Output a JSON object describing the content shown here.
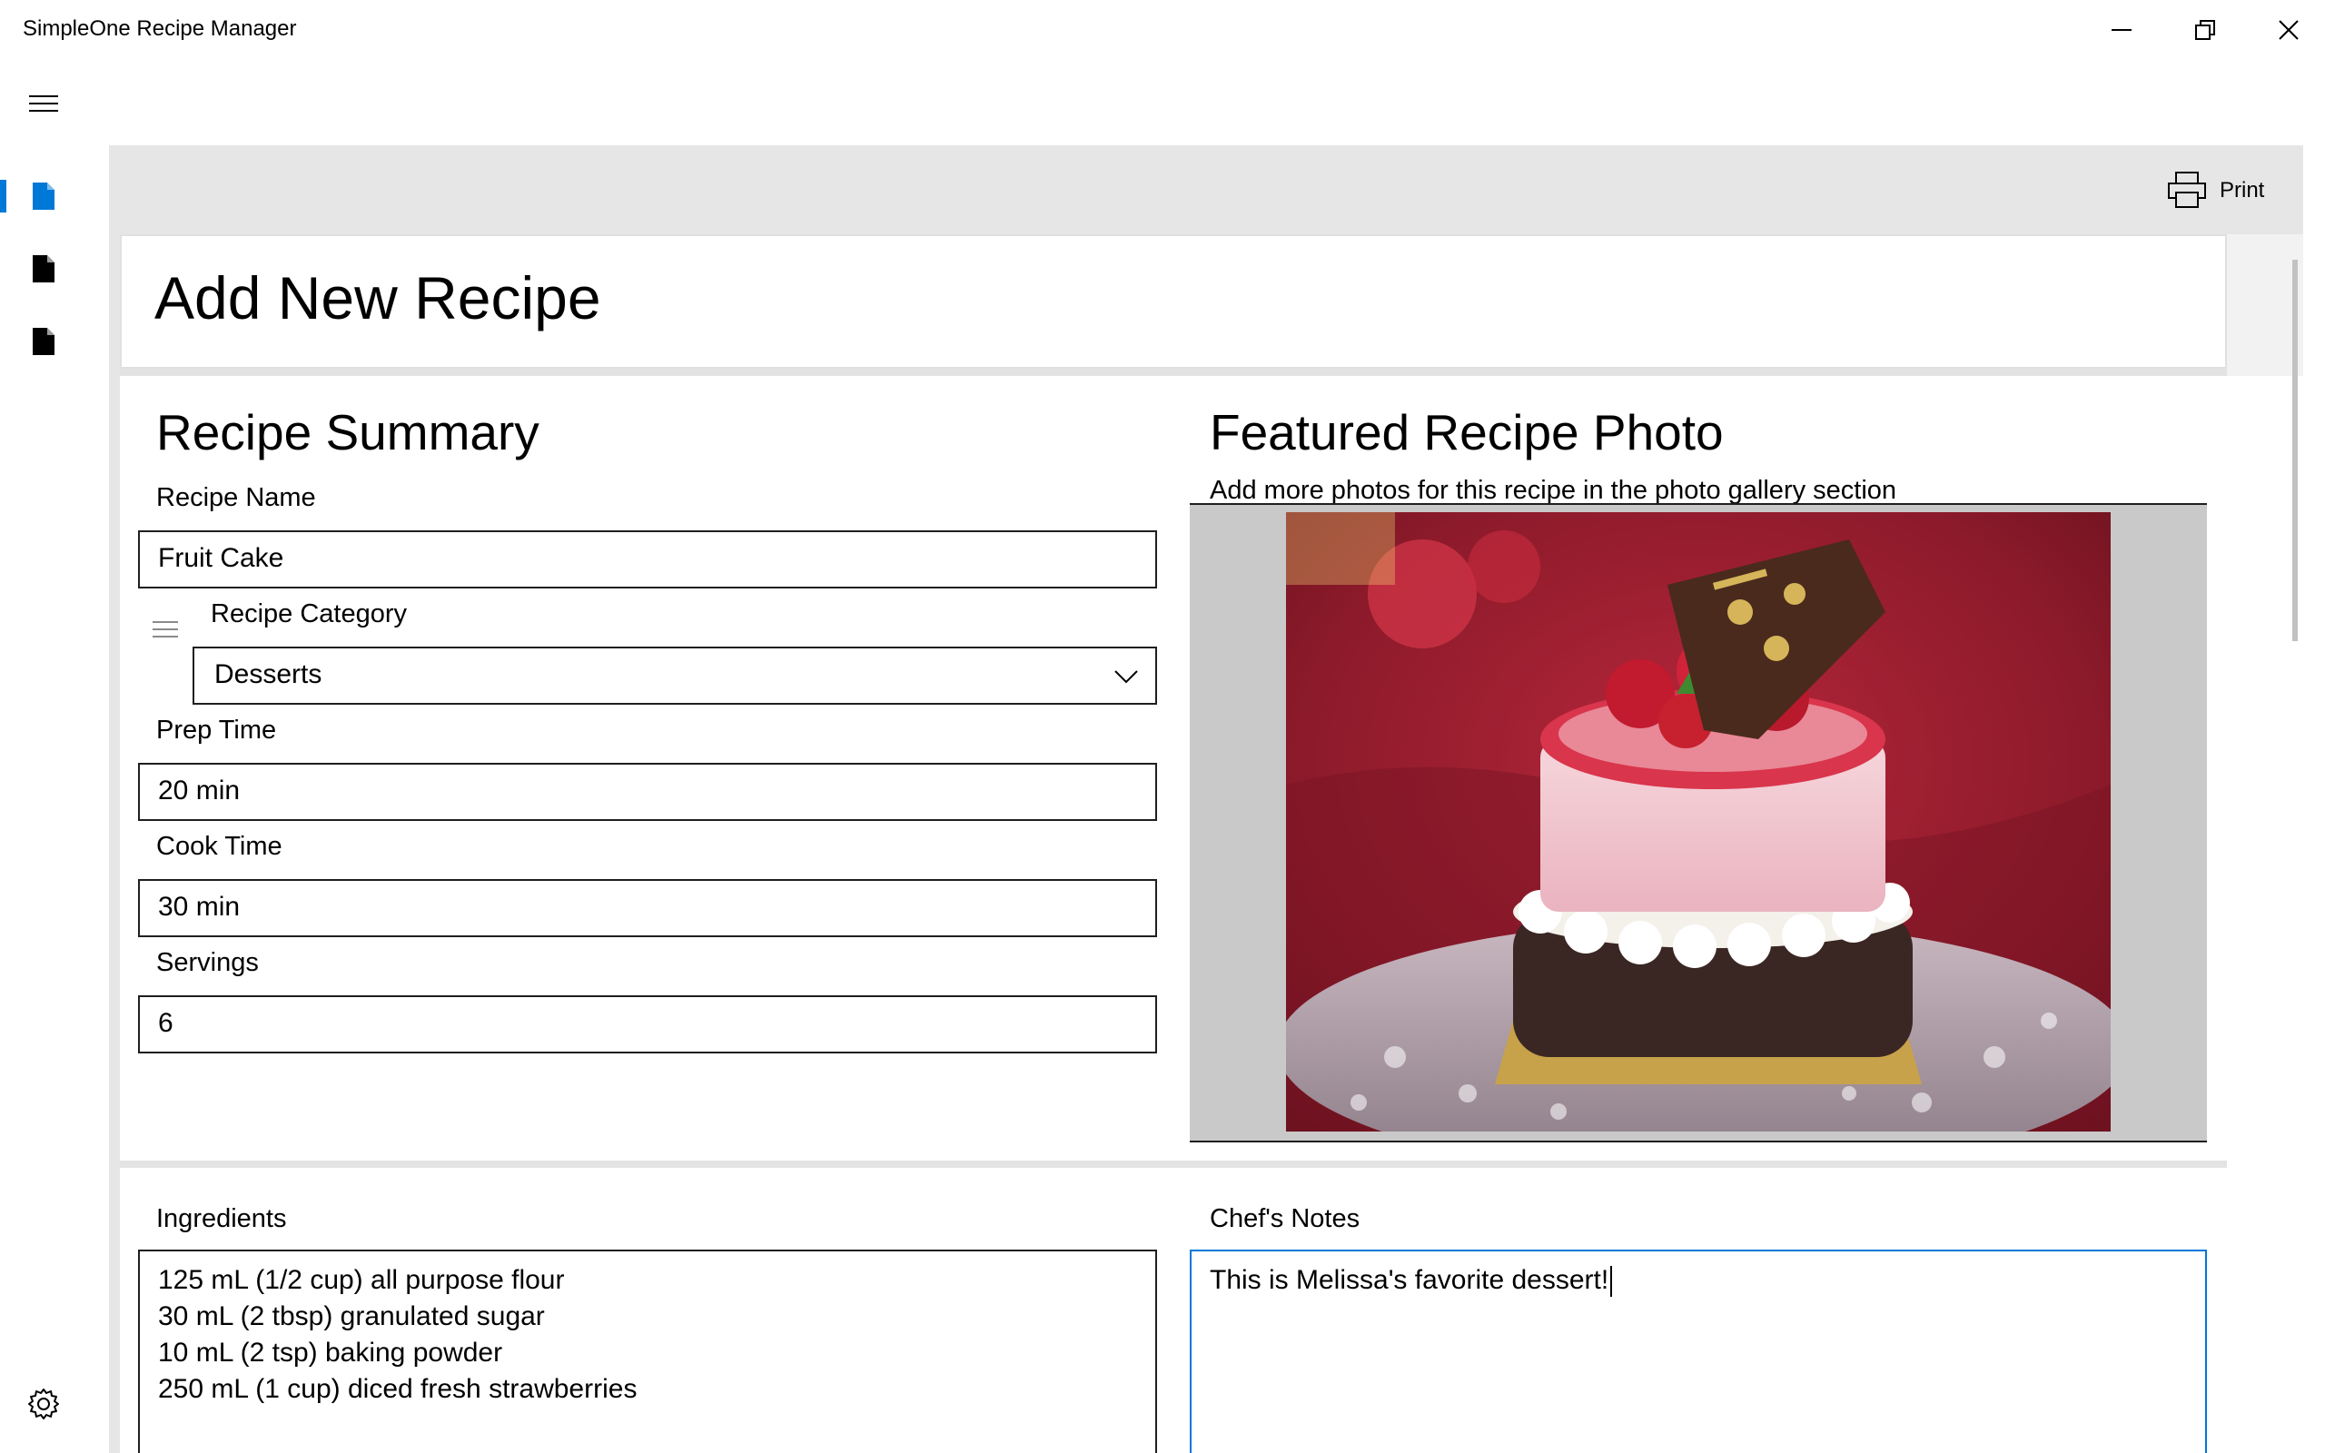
{
  "window": {
    "title": "SimpleOne Recipe Manager"
  },
  "nav": {
    "items": [
      {
        "icon": "document-icon",
        "selected": true
      },
      {
        "icon": "document-icon",
        "selected": false
      },
      {
        "icon": "document-icon",
        "selected": false
      }
    ],
    "accent": "#0078d7"
  },
  "commandbar": {
    "print_label": "Print"
  },
  "page": {
    "title": "Add New Recipe"
  },
  "summary": {
    "title": "Recipe Summary",
    "recipe_name_label": "Recipe Name",
    "recipe_name_value": "Fruit Cake",
    "category_label": "Recipe Category",
    "category_value": "Desserts",
    "prep_time_label": "Prep Time",
    "prep_time_value": "20 min",
    "cook_time_label": "Cook Time",
    "cook_time_value": "30 min",
    "servings_label": "Servings",
    "servings_value": "6"
  },
  "photo": {
    "title": "Featured Recipe Photo",
    "subtitle": "Add more photos for this recipe in the photo gallery section"
  },
  "ingredients": {
    "label": "Ingredients",
    "lines": [
      "125 mL (1/2 cup) all purpose flour",
      "30 mL (2 tbsp) granulated sugar",
      "10 mL (2 tsp) baking powder",
      "250 mL (1 cup) diced fresh strawberries"
    ]
  },
  "notes": {
    "label": "Chef's Notes",
    "value": "This is Melissa's favorite dessert!"
  }
}
